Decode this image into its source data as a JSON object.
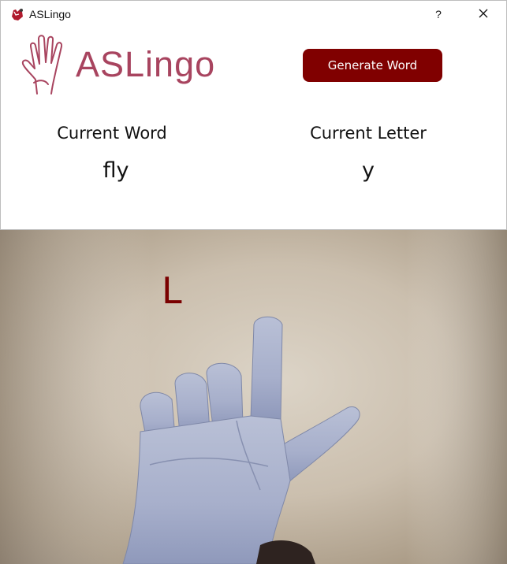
{
  "window": {
    "title": "ASLingo",
    "help_label": "?",
    "close_label": "✕"
  },
  "header": {
    "logo_text": "ASLingo",
    "generate_button_label": "Generate Word"
  },
  "info": {
    "current_word_label": "Current Word",
    "current_word_value": "fly",
    "current_letter_label": "Current Letter",
    "current_letter_value": "y"
  },
  "camera": {
    "detected_letter": "L"
  },
  "colors": {
    "accent": "#800000",
    "logo": "#a8445f",
    "detected_letter": "#7a0000"
  },
  "icons": {
    "app": "hand-icon",
    "logo": "hand-icon",
    "help": "help-icon",
    "close": "close-icon"
  }
}
